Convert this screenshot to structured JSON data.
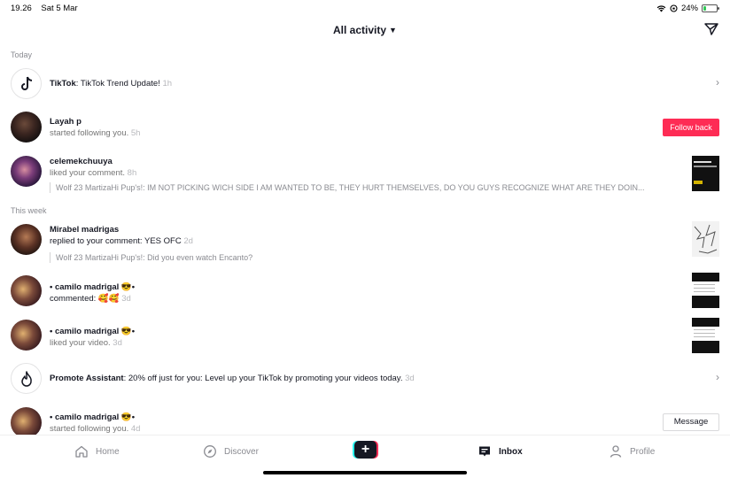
{
  "status": {
    "time": "19.26",
    "date": "Sat 5 Mar",
    "battery": "24%",
    "battery_level": 0.24
  },
  "header": {
    "title": "All activity"
  },
  "sections": {
    "today": "Today",
    "this_week": "This week"
  },
  "items": [
    {
      "name": "TikTok",
      "text": ": TikTok Trend Update!",
      "time": "1h"
    },
    {
      "name": "Layah p",
      "text": "started following you.",
      "time": "5h",
      "action": "Follow back"
    },
    {
      "name": "celemekchuuya",
      "text": "liked your comment.",
      "time": "8h",
      "quote": "Wolf 23 MartizaHi Pup's!: IM NOT PICKING WICH SIDE I AM WANTED TO BE, THEY HURT THEMSELVES, DO YOU GUYS RECOGNIZE WHAT ARE THEY DOIN..."
    },
    {
      "name": "Mirabel madrigas",
      "text": "replied to your comment: YES OFC",
      "time": "2d",
      "quote": "Wolf 23 MartizaHi Pup's!: Did you even watch Encanto?"
    },
    {
      "name": "• camilo madrigal 😎•",
      "text": "commented: 🥰🥰",
      "time": "3d"
    },
    {
      "name": "• camilo madrigal 😎•",
      "text": "liked your video.",
      "time": "3d"
    },
    {
      "name": "Promote Assistant",
      "text": ": 20% off just for you: Level up your TikTok by promoting your videos today.",
      "time": "3d"
    },
    {
      "name": "• camilo madrigal 😎•",
      "text": "started following you.",
      "time": "4d",
      "action": "Message"
    }
  ],
  "tabs": {
    "home": "Home",
    "discover": "Discover",
    "inbox": "Inbox",
    "profile": "Profile"
  },
  "colors": {
    "accent": "#fe2c55",
    "cyan": "#25f4ee",
    "battery": "#34c759"
  },
  "icons": [
    "wifi-icon",
    "battery-icon",
    "send-icon",
    "tiktok-logo-icon",
    "flame-icon",
    "chevron-right-icon",
    "home-icon",
    "compass-icon",
    "plus-icon",
    "inbox-icon",
    "person-icon"
  ]
}
